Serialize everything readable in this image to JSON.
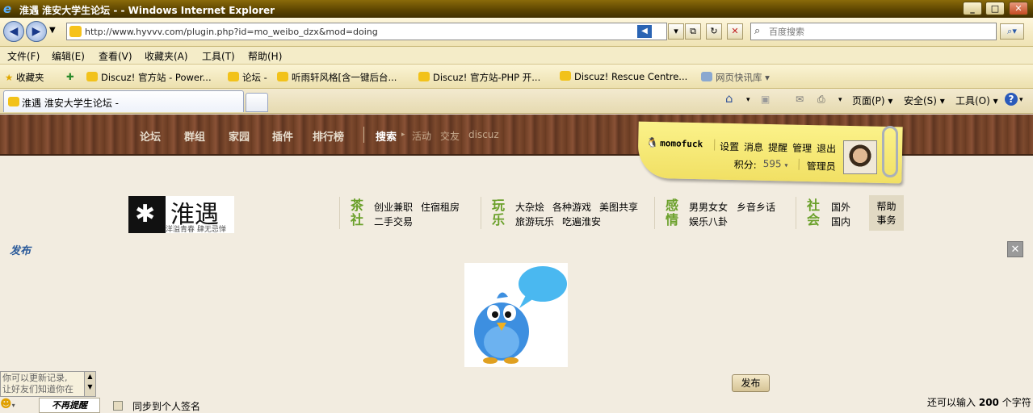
{
  "window": {
    "title": "淮遇 淮安大学生论坛 - - Windows Internet Explorer"
  },
  "address": {
    "url": "http://www.hyvvv.com/plugin.php?id=mo_weibo_dzx&mod=doing",
    "search_placeholder": "百度搜索"
  },
  "menu": [
    "文件(F)",
    "编辑(E)",
    "查看(V)",
    "收藏夹(A)",
    "工具(T)",
    "帮助(H)"
  ],
  "favorites": {
    "label": "收藏夹",
    "items": [
      "Discuz! 官方站 - Power...",
      "论坛 -",
      "听雨轩风格[含一键后台...",
      "Discuz! 官方站-PHP 开...",
      "Discuz! Rescue Centre...",
      "网页快讯库"
    ]
  },
  "tabs": {
    "active": "淮遇 淮安大学生论坛 -"
  },
  "tools": {
    "page": "页面(P)",
    "safety": "安全(S)",
    "tools": "工具(O)"
  },
  "site_nav": {
    "items": [
      "论坛",
      "群组",
      "家园",
      "插件",
      "排行榜"
    ],
    "search": "搜索",
    "sub": [
      "活动",
      "交友",
      "discuz"
    ]
  },
  "user": {
    "name": "momofuck",
    "links": [
      "设置",
      "消息",
      "提醒",
      "管理",
      "退出"
    ],
    "points_label": "积分:",
    "points": "595",
    "role": "管理员"
  },
  "logo": {
    "name": "淮遇",
    "tagline": "洋溢青春 肆无忌惮"
  },
  "categories": [
    {
      "title": [
        "茶",
        "社"
      ],
      "links": [
        "创业兼职",
        "住宿租房",
        "二手交易"
      ]
    },
    {
      "title": [
        "玩",
        "乐"
      ],
      "links": [
        "大杂烩",
        "各种游戏",
        "美图共享",
        "旅游玩乐",
        "吃遍淮安"
      ]
    },
    {
      "title": [
        "感",
        "情"
      ],
      "links": [
        "男男女女",
        "乡音乡话",
        "娱乐八卦"
      ]
    },
    {
      "title": [
        "社",
        "会"
      ],
      "links": [
        "国外",
        "国内"
      ]
    }
  ],
  "help": [
    "帮助",
    "事务"
  ],
  "composer": {
    "heading": "发布",
    "submit": "发布",
    "textarea_lines": [
      "你可以更新记录,",
      "让好友们知道你在"
    ],
    "no_remind": "不再提醒",
    "sync": "同步到个人签名",
    "counter_prefix": "还可以输入",
    "counter_value": "200",
    "counter_suffix": "个字符"
  }
}
